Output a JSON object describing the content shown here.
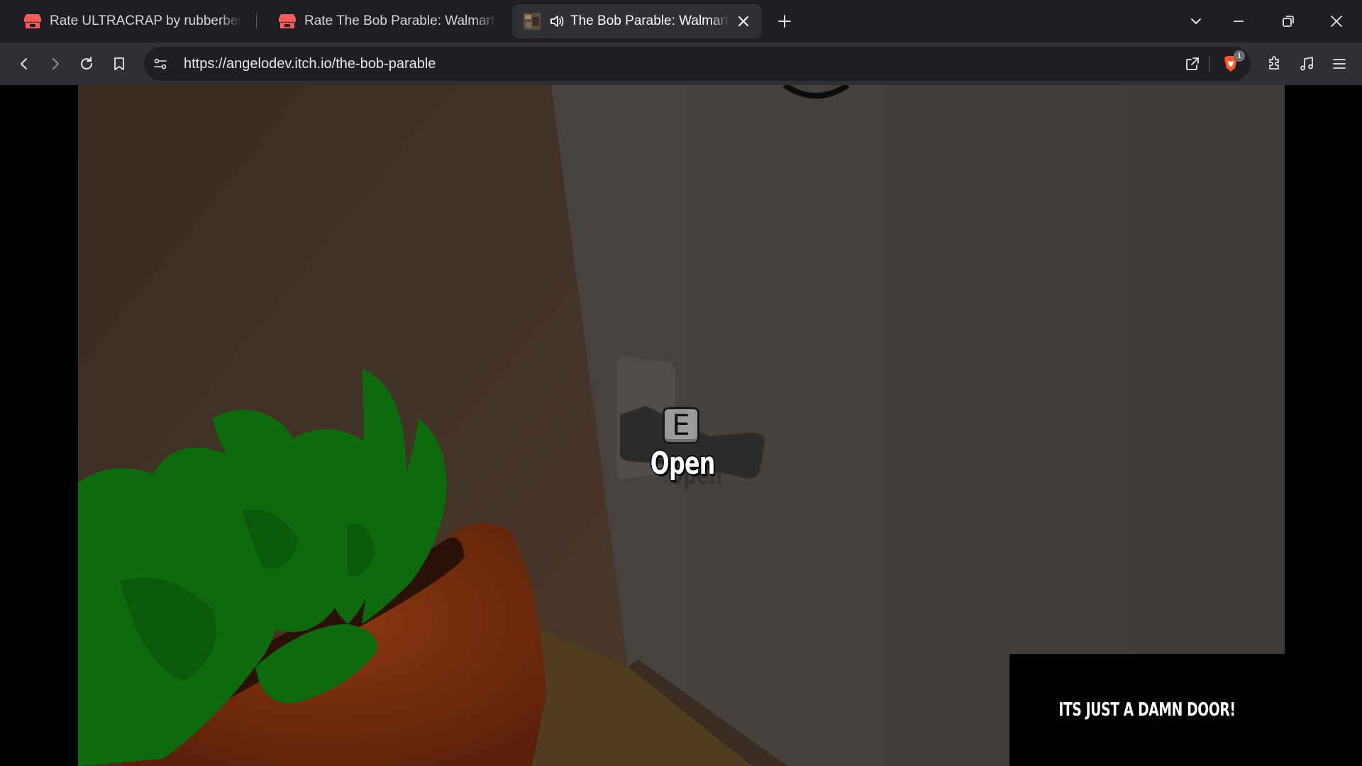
{
  "browser": {
    "tabs": [
      {
        "title": "Rate ULTRACRAP by rubberbeing fo",
        "favicon": "itchio-icon",
        "active": false
      },
      {
        "title": "Rate The Bob Parable: Walmart Bin I",
        "favicon": "itchio-icon",
        "active": false
      },
      {
        "title": "The Bob Parable: Walmart Bi",
        "favicon": "game-thumbnail",
        "active": true,
        "audio": true
      }
    ],
    "url": "https://angelodev.itch.io/the-bob-parable",
    "shields_badge": "1",
    "colors": {
      "tabstrip": "#1e1f22",
      "toolbar": "#2f3035",
      "omnibox": "#1e1f22",
      "itchio_red": "#fa5c5c",
      "brave_orange": "#fb542b"
    }
  },
  "game": {
    "interact_key": "E",
    "interact_action": "Open",
    "subtitle": "ITS JUST A DAMN DOOR!",
    "colors": {
      "wall_left": "#3c2e24",
      "wall_right": "#45403b",
      "floor": "#4f3d1e",
      "leaves": "#0d6a0d",
      "pot": "#7a2e0c"
    }
  }
}
